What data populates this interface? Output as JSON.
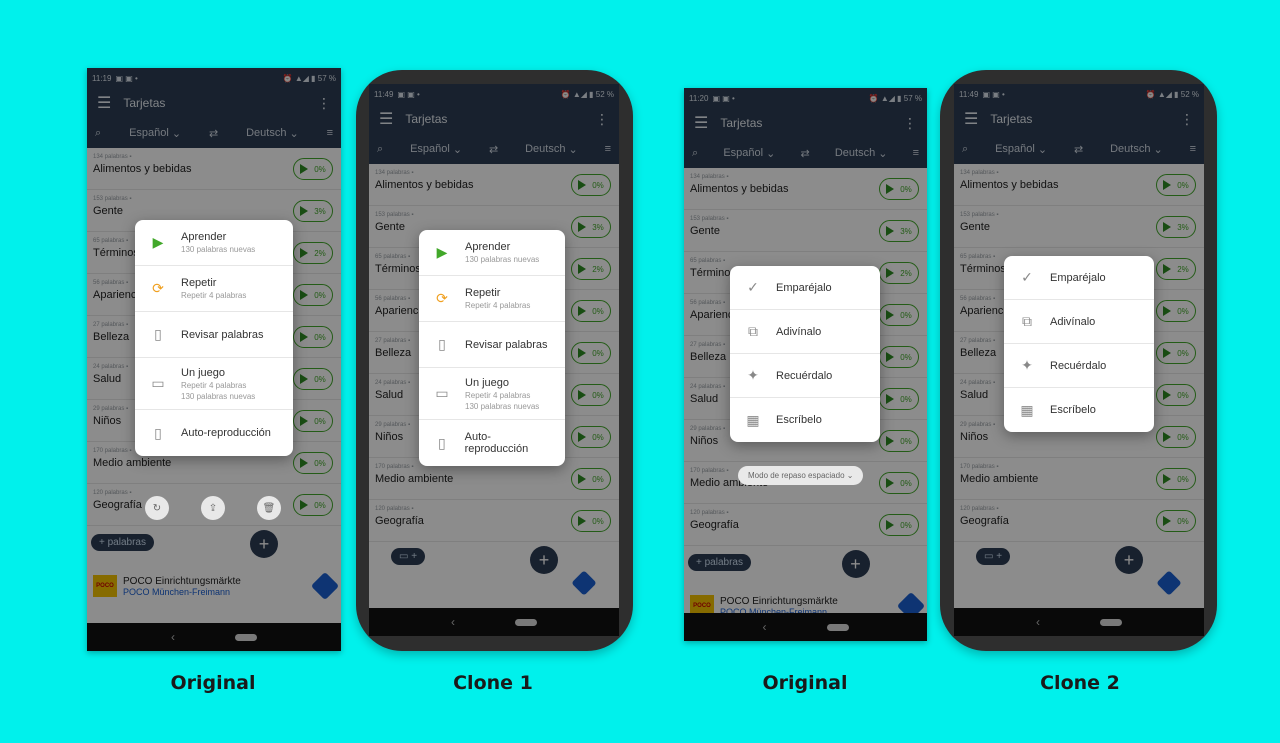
{
  "captions": {
    "c1": "Original",
    "c2": "Clone 1",
    "c3": "Original",
    "c4": "Clone 2"
  },
  "app": {
    "title": "Tarjetas",
    "from_lang": "Español",
    "to_lang": "Deutsch"
  },
  "status": {
    "time_a": "11:19",
    "battery_a": "57 %",
    "time_b": "11:49",
    "battery_b": "52 %",
    "time_c": "11:20",
    "battery_c": "57 %"
  },
  "categories": [
    {
      "count": "134 palabras",
      "name": "Alimentos y bebidas",
      "pct": "0%"
    },
    {
      "count": "153 palabras",
      "name": "Gente",
      "pct": "3%"
    },
    {
      "count": "65 palabras",
      "name": "Términos",
      "pct": "2%"
    },
    {
      "count": "56 palabras",
      "name": "Apariencia",
      "pct": "0%"
    },
    {
      "count": "27 palabras",
      "name": "Belleza",
      "pct": "0%"
    },
    {
      "count": "24 palabras",
      "name": "Salud",
      "pct": "0%"
    },
    {
      "count": "29 palabras",
      "name": "Niños",
      "pct": "0%"
    },
    {
      "count": "170 palabras",
      "name": "Medio ambiente",
      "pct": "0%"
    },
    {
      "count": "120 palabras",
      "name": "Geografía",
      "pct": "0%"
    }
  ],
  "menu1": [
    {
      "label": "Aprender",
      "sub": "130 palabras nuevas",
      "icon": "▶"
    },
    {
      "label": "Repetir",
      "sub": "Repetir 4 palabras",
      "icon": "⟳"
    },
    {
      "label": "Revisar palabras",
      "sub": "",
      "icon": "▯"
    },
    {
      "label": "Un juego",
      "sub": "Repetir 4 palabras",
      "sub2": "130 palabras nuevas",
      "icon": "▭"
    },
    {
      "label": "Auto-reproducción",
      "sub": "",
      "icon": "▯"
    }
  ],
  "menu2": [
    {
      "label": "Emparéjalo",
      "icon": "✓"
    },
    {
      "label": "Adivínalo",
      "icon": "⧉"
    },
    {
      "label": "Recuérdalo",
      "icon": "✦"
    },
    {
      "label": "Escríbelo",
      "icon": "▦"
    }
  ],
  "add_words": "+ palabras",
  "toast": "Modo de repaso espaciado",
  "ad": {
    "name": "POCO Einrichtungsmärkte",
    "place": "POCO München-Freimann",
    "logo": "POCO"
  },
  "colors": {
    "background": "#00f1ec",
    "navy": "#2c3d54",
    "green": "#42a82a",
    "orange": "#f0a020"
  }
}
